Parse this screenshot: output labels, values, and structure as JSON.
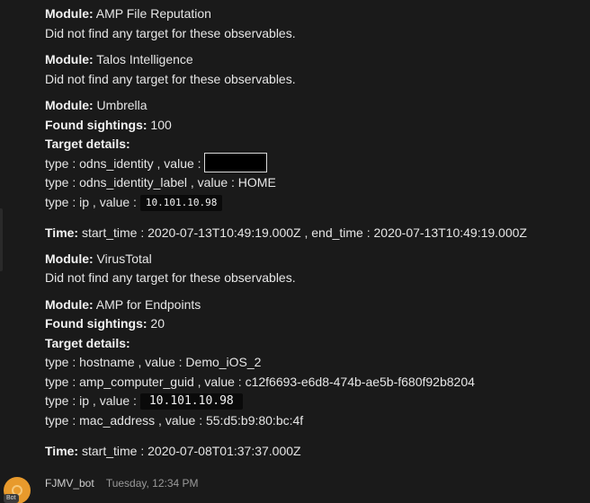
{
  "label_module": "Module:",
  "label_found_sightings": "Found sightings:",
  "label_target_details": "Target details:",
  "label_time": "Time:",
  "no_target_text": "Did not find any target for these observables.",
  "modules": {
    "amp_file_reputation": {
      "name": "AMP File Reputation"
    },
    "talos": {
      "name": "Talos Intelligence"
    },
    "umbrella": {
      "name": "Umbrella",
      "sightings": "100",
      "targets": [
        "type : odns_identity , value :",
        "type : odns_identity_label , value : HOME",
        "type : ip , value :"
      ],
      "ip": "10.101.10.98",
      "time": "start_time : 2020-07-13T10:49:19.000Z , end_time : 2020-07-13T10:49:19.000Z"
    },
    "virustotal": {
      "name": "VirusTotal"
    },
    "amp_endpoints": {
      "name": "AMP for Endpoints",
      "sightings": "20",
      "targets": [
        "type : hostname , value : Demo_iOS_2",
        "type : amp_computer_guid , value : c12f6693-e6d8-474b-ae5b-f680f92b8204",
        "type : ip , value :",
        "type : mac_address , value : 55:d5:b9:80:bc:4f"
      ],
      "ip": "10.101.10.98",
      "time": "start_time : 2020-07-08T01:37:37.000Z"
    }
  },
  "next_message": {
    "author": "FJMV_bot",
    "timestamp": "Tuesday, 12:34 PM",
    "badge": "Bot",
    "avatar_color": "#e89a2c"
  },
  "colors": {
    "background": "#1a1a1a",
    "text": "#e6e6e6"
  }
}
